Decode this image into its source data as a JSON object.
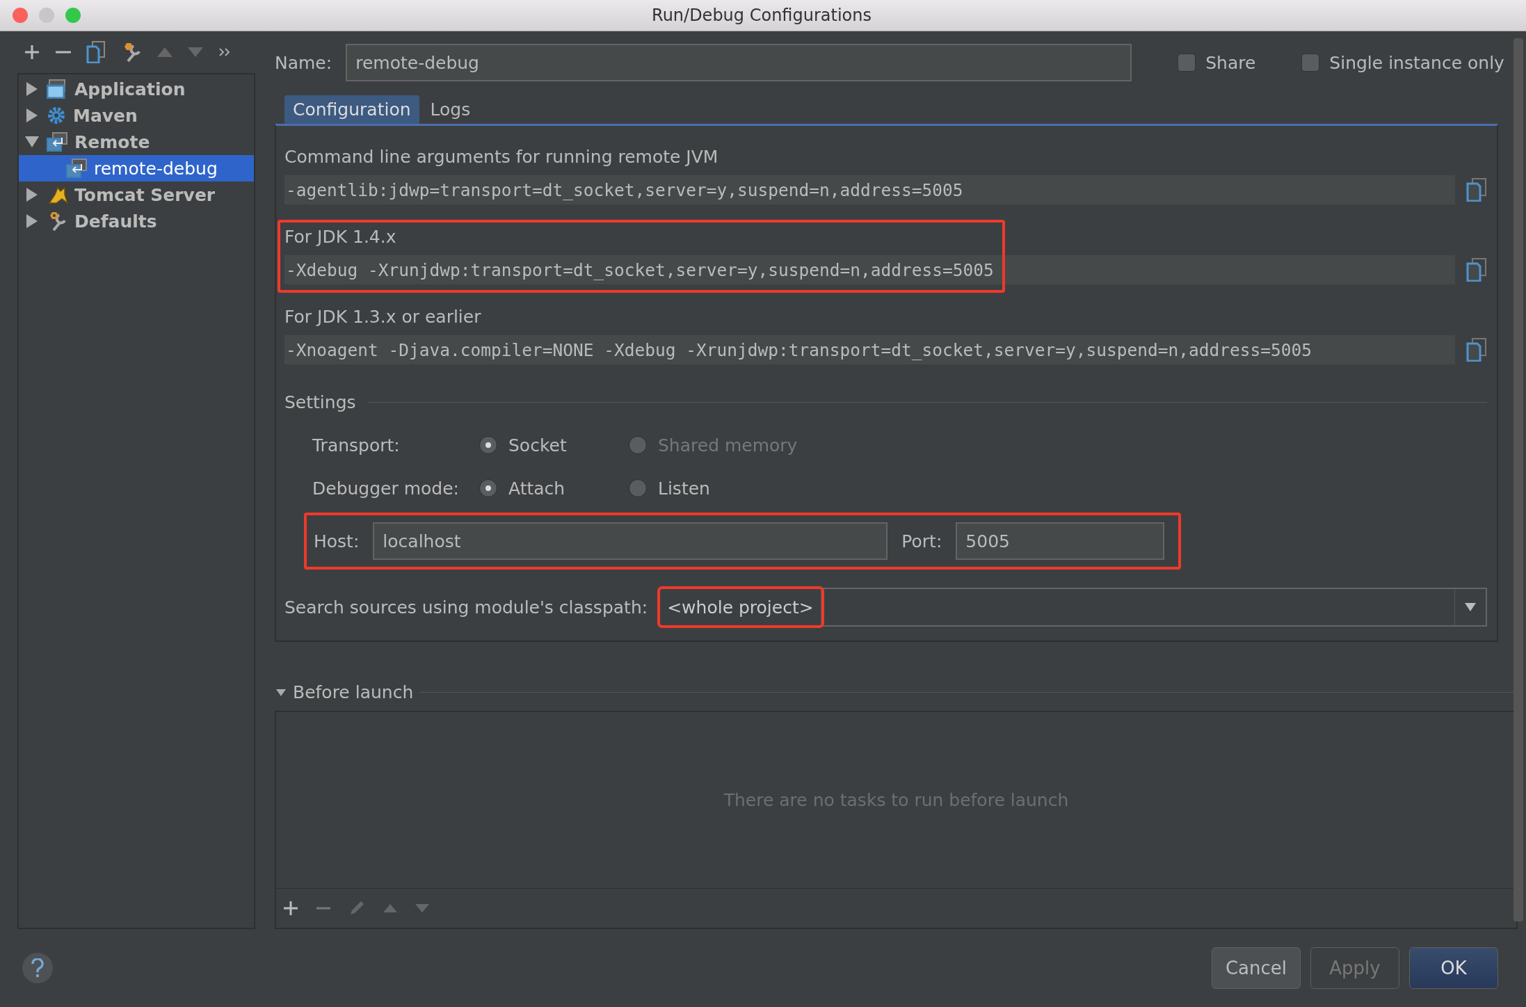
{
  "window": {
    "title": "Run/Debug Configurations"
  },
  "tree": [
    {
      "label": "Application",
      "kind": "application",
      "expanded": false,
      "selected": false
    },
    {
      "label": "Maven",
      "kind": "maven",
      "expanded": false,
      "selected": false
    },
    {
      "label": "Remote",
      "kind": "remote",
      "expanded": true,
      "selected": false,
      "children": [
        {
          "label": "remote-debug",
          "kind": "remote",
          "selected": true
        }
      ]
    },
    {
      "label": "Tomcat Server",
      "kind": "tomcat",
      "expanded": false,
      "selected": false
    },
    {
      "label": "Defaults",
      "kind": "defaults",
      "expanded": false,
      "selected": false
    }
  ],
  "name_field": {
    "label": "Name:",
    "value": "remote-debug"
  },
  "options": [
    {
      "label": "Share",
      "checked": false
    },
    {
      "label": "Single instance only",
      "checked": false
    }
  ],
  "tabs": [
    {
      "label": "Configuration",
      "selected": true
    },
    {
      "label": "Logs",
      "selected": false
    }
  ],
  "arguments": [
    {
      "label": "Command line arguments for running remote JVM",
      "value": "-agentlib:jdwp=transport=dt_socket,server=y,suspend=n,address=5005",
      "highlighted": false
    },
    {
      "label": "For JDK 1.4.x",
      "value": "-Xdebug -Xrunjdwp:transport=dt_socket,server=y,suspend=n,address=5005",
      "highlighted": true
    },
    {
      "label": "For JDK 1.3.x or earlier",
      "value": "-Xnoagent -Djava.compiler=NONE -Xdebug -Xrunjdwp:transport=dt_socket,server=y,suspend=n,address=5005",
      "highlighted": false
    }
  ],
  "settings": {
    "title": "Settings",
    "radio_groups": [
      {
        "label": "Transport:",
        "options": [
          {
            "label": "Socket",
            "selected": true,
            "disabled": false
          },
          {
            "label": "Shared memory",
            "selected": false,
            "disabled": true
          }
        ]
      },
      {
        "label": "Debugger mode:",
        "options": [
          {
            "label": "Attach",
            "selected": true,
            "disabled": false
          },
          {
            "label": "Listen",
            "selected": false,
            "disabled": false
          }
        ]
      }
    ],
    "host": {
      "label": "Host:",
      "value": "localhost"
    },
    "port": {
      "label": "Port:",
      "value": "5005"
    },
    "address_highlighted": true,
    "classpath": {
      "label": "Search sources using module's classpath:",
      "value": "<whole project>",
      "highlighted": true
    }
  },
  "before_launch": {
    "title": "Before launch",
    "expanded": true,
    "empty_text": "There are no tasks to run before launch"
  },
  "buttons": [
    {
      "label": "Cancel",
      "kind": "normal",
      "disabled": false
    },
    {
      "label": "Apply",
      "kind": "normal",
      "disabled": true
    },
    {
      "label": "OK",
      "kind": "default",
      "disabled": false
    }
  ]
}
